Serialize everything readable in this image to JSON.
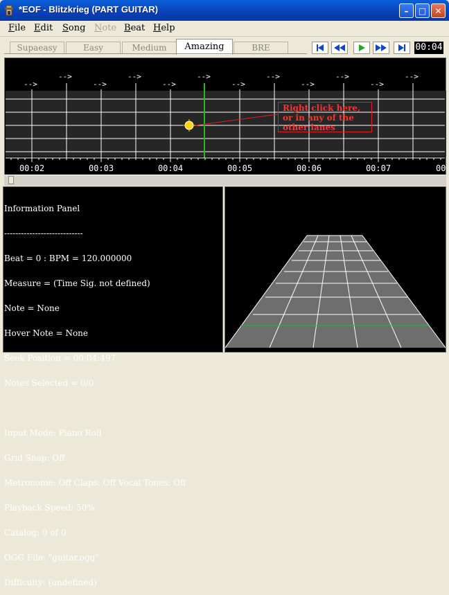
{
  "window": {
    "title": "*EOF - Blitzkrieg (PART GUITAR)",
    "buttons": {
      "minimize": "–",
      "maximize": "□",
      "close": "✕"
    }
  },
  "menu": [
    {
      "label": "File",
      "mnemonic": "F",
      "rest": "ile",
      "disabled": false
    },
    {
      "label": "Edit",
      "mnemonic": "E",
      "rest": "dit",
      "disabled": false
    },
    {
      "label": "Song",
      "mnemonic": "S",
      "rest": "ong",
      "disabled": false
    },
    {
      "label": "Note",
      "mnemonic": "N",
      "rest": "ote",
      "disabled": true
    },
    {
      "label": "Beat",
      "mnemonic": "B",
      "rest": "eat",
      "disabled": false
    },
    {
      "label": "Help",
      "mnemonic": "H",
      "rest": "elp",
      "disabled": false
    }
  ],
  "difficulty_tabs": [
    {
      "label": "Supaeasy",
      "active": false
    },
    {
      "label": "Easy",
      "active": false
    },
    {
      "label": "Medium",
      "active": false
    },
    {
      "label": "Amazing",
      "active": true
    },
    {
      "label": "BRE",
      "active": false
    }
  ],
  "transport": {
    "buttons": [
      "skip-to-start-icon",
      "rewind-icon",
      "play-icon",
      "fast-forward-icon",
      "skip-to-end-icon"
    ],
    "time": "00:04"
  },
  "editor": {
    "beat_marker": "-->",
    "timeline_labels": [
      "00:02",
      "00:03",
      "00:04",
      "00:05",
      "00:06",
      "00:07",
      "00"
    ],
    "callout": "Right click here, or in any of the other lanes",
    "colors": {
      "callout": "#ff3232",
      "note": "#ffd21e",
      "position_line": "#22bb22"
    }
  },
  "info_panel": {
    "lines": [
      "Information Panel",
      "----------------------------",
      "Beat = 0 : BPM = 120.000000",
      "Measure = (Time Sig. not defined)",
      "Note = None",
      "Hover Note = None",
      "Seek Position = 00:04:497",
      "Notes Selected = 0/0",
      "",
      "Input Mode: Piano Roll",
      "Grid Snap: Off",
      "Metronome: Off Claps: Off Vocal Tones: Off",
      "Playback Speed: 50%",
      "Catalog: 0 of 0",
      "OGG File: \"guitar.ogg\"",
      "Difficulty: (undefined)"
    ]
  }
}
